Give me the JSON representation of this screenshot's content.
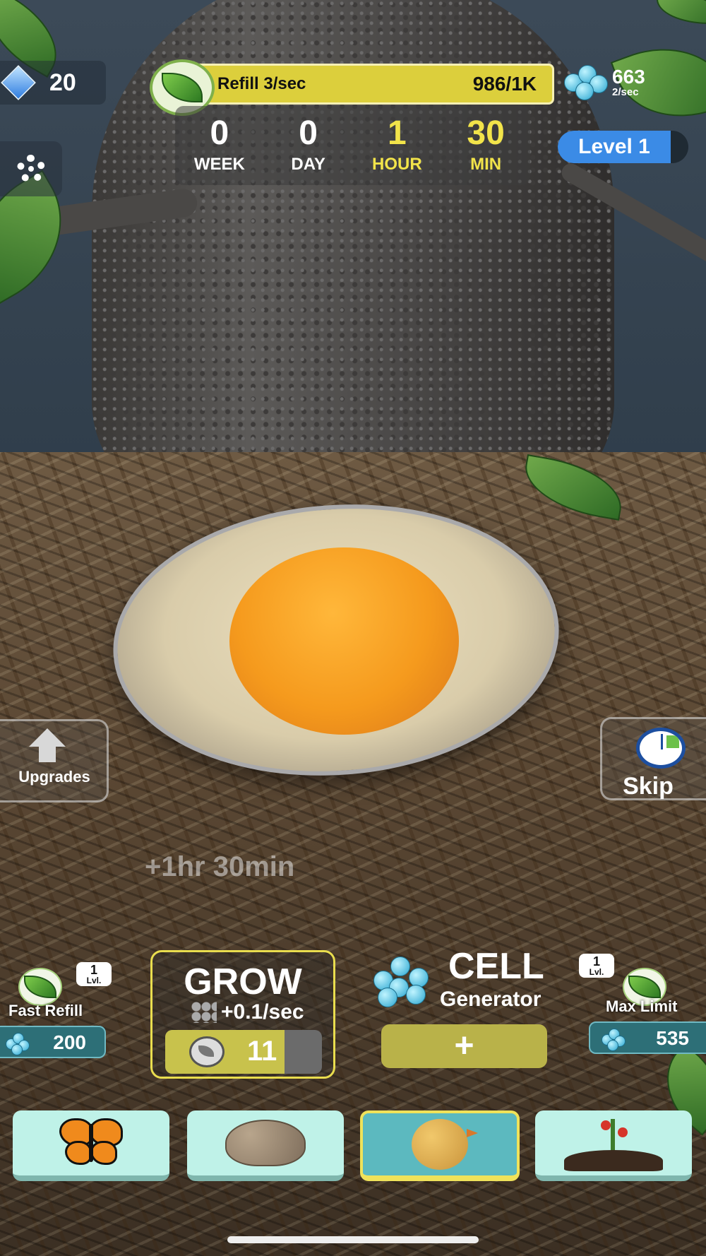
{
  "hud": {
    "gems": "20",
    "refill_label": "Refill 3/sec",
    "refill_value": "986/1K",
    "refill_progress": 0.986,
    "cells_count": "663",
    "cells_rate": "2/sec",
    "level": "Level 1",
    "timer": [
      {
        "value": "0",
        "label": "WEEK"
      },
      {
        "value": "0",
        "label": "DAY"
      },
      {
        "value": "1",
        "label": "HOUR"
      },
      {
        "value": "30",
        "label": "MIN"
      }
    ]
  },
  "side": {
    "upgrades_label": "Upgrades",
    "skip_label": "Skip"
  },
  "floating_text": "+1hr 30min",
  "panels": {
    "fast_refill": {
      "label": "Fast Refill",
      "level": "1",
      "level_suffix": "Lvl.",
      "cost": "200"
    },
    "grow": {
      "title": "GROW",
      "rate": "+0.1/sec",
      "cost": "11"
    },
    "cell_generator": {
      "title": "CELL",
      "subtitle": "Generator",
      "button": "+"
    },
    "max_limit": {
      "label": "Max Limit",
      "level": "1",
      "level_suffix": "Lvl.",
      "cost": "535"
    }
  },
  "tabs": [
    {
      "name": "butterfly",
      "active": false
    },
    {
      "name": "frog",
      "active": false
    },
    {
      "name": "chick",
      "active": true
    },
    {
      "name": "plant",
      "active": false
    }
  ],
  "colors": {
    "accent_yellow": "#dccf3c",
    "level_blue": "#3b8be6",
    "tab_active": "#5cb9bf"
  }
}
